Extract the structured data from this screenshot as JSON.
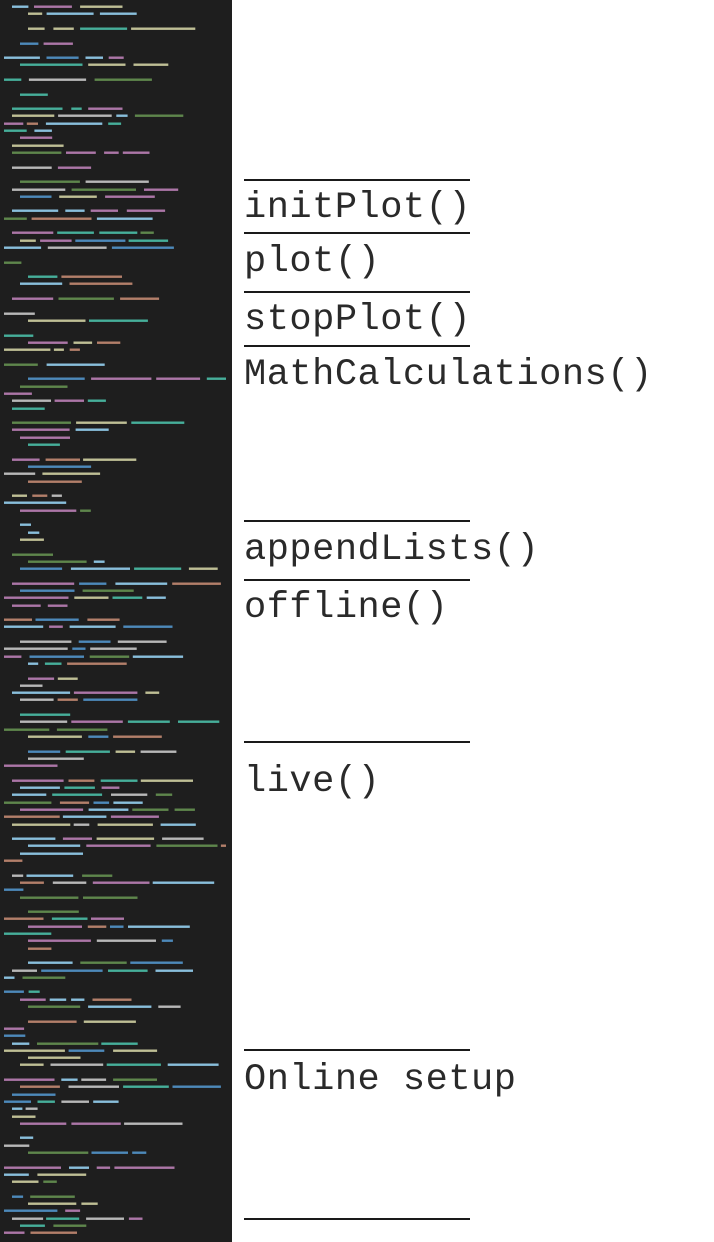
{
  "code_panel": {
    "background": "#1e1e1e",
    "text_colors": [
      "#c586c0",
      "#9cdcfe",
      "#4ec9b0",
      "#dcdcaa",
      "#ce9178",
      "#6a9955",
      "#569cd6",
      "#d4d4d4"
    ]
  },
  "sections": [
    {
      "label": "initPlot()"
    },
    {
      "label": "plot()"
    },
    {
      "label": "stopPlot()"
    },
    {
      "label": "MathCalculations()"
    },
    {
      "label": "appendLists()"
    },
    {
      "label": "offline()"
    },
    {
      "label": "live()"
    },
    {
      "label": "Online setup"
    }
  ]
}
